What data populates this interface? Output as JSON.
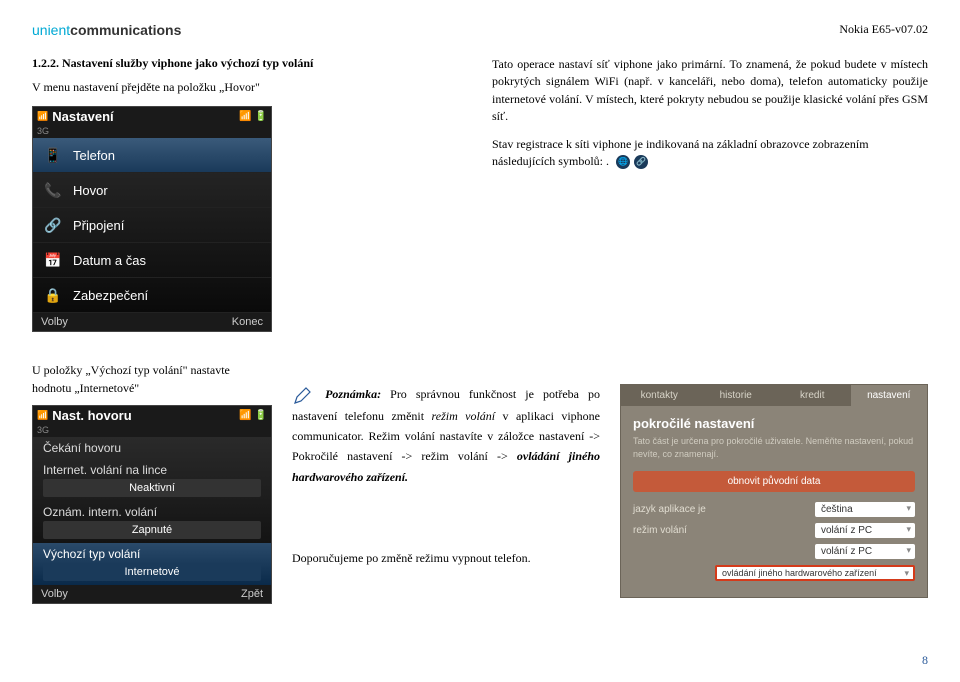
{
  "header": {
    "company_cyan": "unient",
    "company_bold": "communications",
    "doc_id": "Nokia E65-v07.02"
  },
  "section_1_2_2": {
    "number": "1.2.2.",
    "title": "Nastavení služby viphone jako výchozí typ volání",
    "intro": "V menu nastavení přejděte na položku „Hovor\""
  },
  "phone1": {
    "title": "Nastavení",
    "sig_3g": "3G",
    "items": [
      "Telefon",
      "Hovor",
      "Připojení",
      "Datum a čas",
      "Zabezpečení"
    ],
    "icons": [
      "📱",
      "📞",
      "🔗",
      "📅",
      "🔒"
    ],
    "soft_left": "Volby",
    "soft_right": "Konec"
  },
  "caption1": "U položky „Výchozí typ volání\" nastavte hodnotu „Internetové\"",
  "phone2": {
    "title": "Nast. hovoru",
    "sig_3g": "3G",
    "rows": [
      {
        "label": "Čekání hovoru",
        "value": ""
      },
      {
        "label": "Internet. volání na lince",
        "value": "Neaktivní"
      },
      {
        "label": "Oznám. intern. volání",
        "value": "Zapnuté"
      },
      {
        "label": "Výchozí typ volání",
        "value": "Internetové"
      }
    ],
    "soft_left": "Volby",
    "soft_right": "Zpět"
  },
  "right_text": {
    "p1": "Tato operace nastaví síť viphone jako primární. To znamená, že pokud budete v místech pokrytých signálem WiFi (např. v kanceláři, nebo doma), telefon automaticky použije internetové volání. V místech, které pokryty nebudou se použije klasické volání přes GSM síť.",
    "p2": "Stav registrace k síti viphone je indikovaná na základní obrazovce zobrazením následujících symbolů: ."
  },
  "note": {
    "title": "Poznámka:",
    "text_1": "Pro správnou funkčnost je potřeba po nastavení telefonu změnit",
    "text_2": "režim volání",
    "text_3": "v aplikaci viphone communicator. Režim volání nastavíte v záložce nastavení -> Pokročilé nastavení -> režim volání ->",
    "text_4": "ovládání jiného hardwarového zařízení."
  },
  "web": {
    "tabs": [
      "kontakty",
      "historie",
      "kredit",
      "nastavení"
    ],
    "heading": "pokročilé nastavení",
    "desc": "Tato část je určena pro pokročilé uživatele. Neměňte nastavení, pokud nevíte, co znamenají.",
    "btn": "obnovit původní data",
    "field1_label": "jazyk aplikace je",
    "field1_value": "čeština",
    "field2_label": "režim volání",
    "field2_value": "volání z PC",
    "field3_value": "volání z PC",
    "field4_value": "ovládání jiného hardwarového zařízení"
  },
  "recommend": "Doporučujeme po změně režimu vypnout telefon.",
  "page_num": "8"
}
